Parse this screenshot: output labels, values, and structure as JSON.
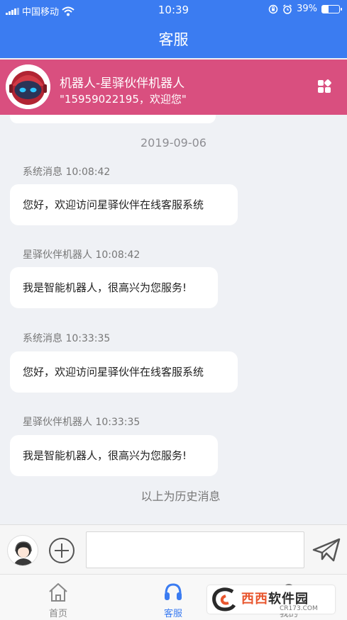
{
  "status_bar": {
    "carrier": "中国移动",
    "time": "10:39",
    "battery_text": "39%",
    "battery_level": 0.39
  },
  "header": {
    "title": "客服"
  },
  "bot": {
    "name": "机器人-星驿伙伴机器人",
    "phone_greeting": "\"15959022195，欢迎您\""
  },
  "chat": {
    "date": "2019-09-06",
    "messages": [
      {
        "sender": "系统消息 10:08:42",
        "text": "您好，欢迎访问星驿伙伴在线客服系统"
      },
      {
        "sender": "星驿伙伴机器人 10:08:42",
        "text": "我是智能机器人，很高兴为您服务!"
      },
      {
        "sender": "系统消息 10:33:35",
        "text": "您好，欢迎访问星驿伙伴在线客服系统"
      },
      {
        "sender": "星驿伙伴机器人 10:33:35",
        "text": "我是智能机器人，很高兴为您服务!"
      }
    ],
    "history_label": "以上为历史消息"
  },
  "input": {
    "value": "",
    "placeholder": ""
  },
  "tabs": [
    {
      "label": "首页",
      "icon": "home-icon",
      "active": false
    },
    {
      "label": "客服",
      "icon": "headset-icon",
      "active": true
    },
    {
      "label": "我的",
      "icon": "profile-icon",
      "active": false
    }
  ],
  "watermark": {
    "brand_main": "西西",
    "brand_soft": "软件园",
    "url": "CR173.COM"
  },
  "colors": {
    "primary": "#3b7cf1",
    "bot_bar": "#d94f7f",
    "background": "#eff1f5"
  }
}
